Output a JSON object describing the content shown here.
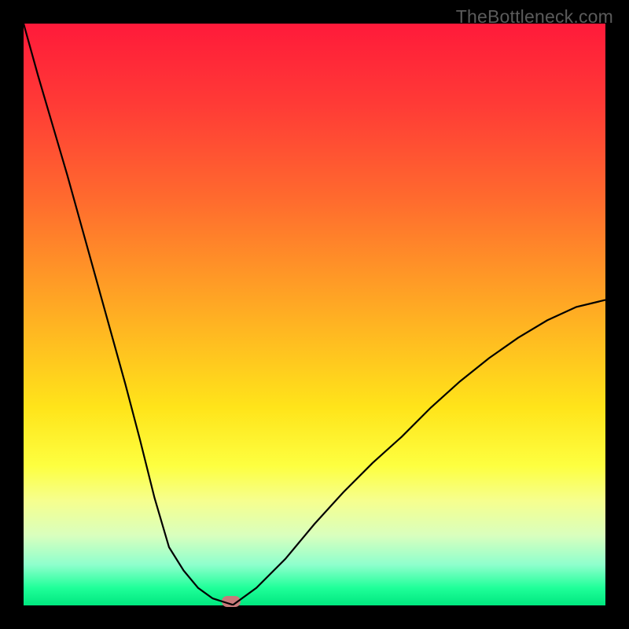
{
  "watermark": "TheBottleneck.com",
  "chart_data": {
    "type": "line",
    "title": "",
    "xlabel": "",
    "ylabel": "",
    "x": [
      0,
      0.025,
      0.05,
      0.075,
      0.1,
      0.125,
      0.15,
      0.175,
      0.2,
      0.225,
      0.25,
      0.275,
      0.3,
      0.325,
      0.35,
      0.36,
      0.4,
      0.45,
      0.5,
      0.55,
      0.6,
      0.65,
      0.7,
      0.75,
      0.8,
      0.85,
      0.9,
      0.95,
      1.0
    ],
    "values": [
      100,
      91,
      82.5,
      74,
      65,
      56,
      47,
      38,
      28.5,
      18.5,
      10,
      6,
      3,
      1.2,
      0.4,
      0.1,
      3,
      8,
      14,
      19.5,
      24.5,
      29,
      34,
      38.5,
      42.5,
      46,
      49,
      51.3,
      52.5
    ],
    "xlim": [
      0,
      1
    ],
    "ylim": [
      0,
      100
    ],
    "gradient_colors": [
      "#ff1a3a",
      "#ff6a2e",
      "#ffe41a",
      "#00e77f"
    ],
    "marker": {
      "x": 0.357,
      "y": 0.5,
      "color": "#c77a7a"
    }
  }
}
